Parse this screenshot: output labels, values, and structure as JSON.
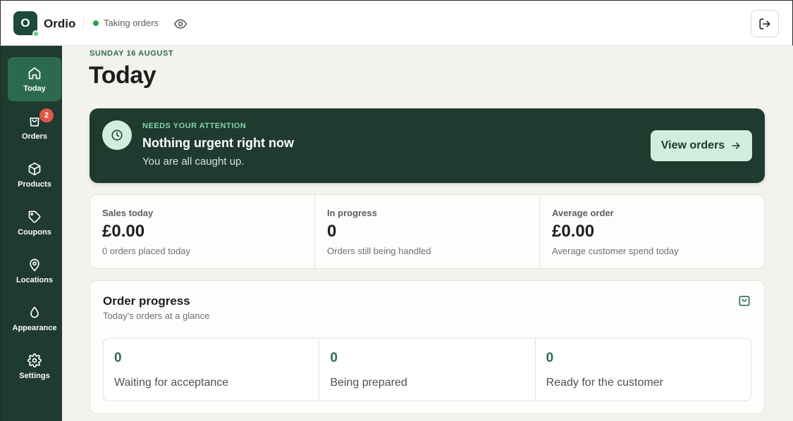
{
  "app": {
    "logo_letter": "O",
    "name": "Ordio",
    "status_label": "Taking orders",
    "status_color": "#2aa14f",
    "preview_icon": "eye-icon",
    "logout_icon": "logout-icon"
  },
  "sidebar": {
    "items": [
      {
        "label": "Today",
        "icon": "home-icon",
        "active": true
      },
      {
        "label": "Orders",
        "icon": "bag-icon",
        "badge": "2"
      },
      {
        "label": "Products",
        "icon": "box-icon"
      },
      {
        "label": "Coupons",
        "icon": "tag-icon"
      },
      {
        "label": "Locations",
        "icon": "map-pin-icon"
      },
      {
        "label": "Appearance",
        "icon": "drop-icon"
      },
      {
        "label": "Settings",
        "icon": "gear-icon"
      }
    ]
  },
  "header": {
    "date": "SUNDAY 16 AUGUST",
    "title": "Today"
  },
  "attention": {
    "eyebrow": "NEEDS YOUR ATTENTION",
    "title": "Nothing urgent right now",
    "subtitle": "You are all caught up.",
    "button_label": "View orders",
    "icon": "clock-icon"
  },
  "stats": [
    {
      "label": "Sales today",
      "value": "£0.00",
      "sub": "0 orders placed today"
    },
    {
      "label": "In progress",
      "value": "0",
      "sub": "Orders still being handled"
    },
    {
      "label": "Average order",
      "value": "£0.00",
      "sub": "Average customer spend today"
    }
  ],
  "order_progress": {
    "title": "Order progress",
    "subtitle": "Today's orders at a glance",
    "icon": "bag-icon",
    "cells": [
      {
        "value": "0",
        "label": "Waiting for acceptance"
      },
      {
        "value": "0",
        "label": "Being prepared"
      },
      {
        "value": "0",
        "label": "Ready for the customer"
      }
    ]
  },
  "colors": {
    "sidebar_bg": "#1f3a2f",
    "accent": "#2e6b55",
    "mint": "#cfeedd",
    "badge": "#e0574a"
  }
}
